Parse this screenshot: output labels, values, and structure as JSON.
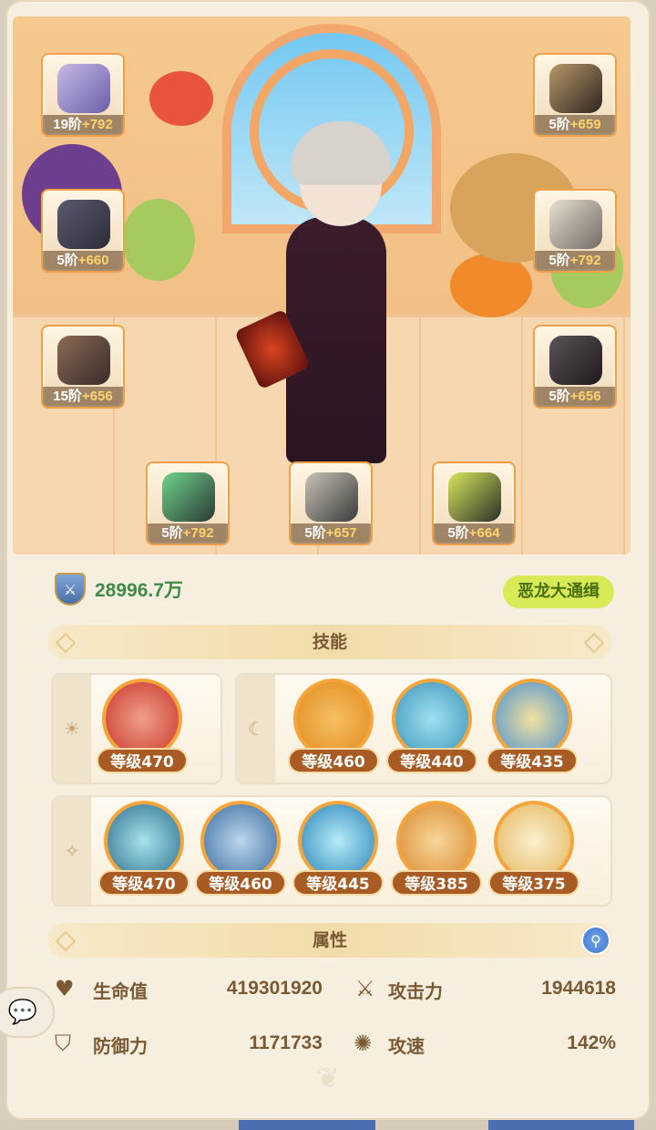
{
  "equipment": {
    "left": [
      {
        "name": "sword",
        "tier": "19阶",
        "bonus": "+792"
      },
      {
        "name": "chest-armor",
        "tier": "5阶",
        "bonus": "+660"
      },
      {
        "name": "leg-armor",
        "tier": "15阶",
        "bonus": "+656"
      }
    ],
    "right": [
      {
        "name": "helmet",
        "tier": "5阶",
        "bonus": "+659"
      },
      {
        "name": "gauntlets",
        "tier": "5阶",
        "bonus": "+792"
      },
      {
        "name": "boots",
        "tier": "5阶",
        "bonus": "+656"
      }
    ],
    "bottom": [
      {
        "name": "ring",
        "tier": "5阶",
        "bonus": "+792"
      },
      {
        "name": "necklace",
        "tier": "5阶",
        "bonus": "+657"
      },
      {
        "name": "amulet",
        "tier": "5阶",
        "bonus": "+664"
      }
    ]
  },
  "power": {
    "value": "28996.7万",
    "icon": "shield-sword-icon"
  },
  "bounty_label": "恶龙大通缉",
  "skills_header": "技能",
  "skill_rows": {
    "row1_left": {
      "icon": "sun-icon",
      "skills": [
        {
          "level": "等级470",
          "color": "#c9362b"
        }
      ]
    },
    "row1_right": {
      "icon": "moon-icon",
      "skills": [
        {
          "level": "等级460",
          "color": "#e08a1c"
        },
        {
          "level": "等级440",
          "color": "#3d95b8"
        },
        {
          "level": "等级435",
          "color": "#4a8fd0"
        }
      ]
    },
    "row2": {
      "icon": "star-icon",
      "skills": [
        {
          "level": "等级470",
          "color": "#2d6f8e"
        },
        {
          "level": "等级460",
          "color": "#3b6d9e"
        },
        {
          "level": "等级445",
          "color": "#2a84b5"
        },
        {
          "level": "等级385",
          "color": "#d98a2e"
        },
        {
          "level": "等级375",
          "color": "#e4b65c"
        }
      ]
    }
  },
  "attributes_header": "属性",
  "stats": [
    {
      "icon": "heart-icon",
      "label": "生命值",
      "value": "419301920"
    },
    {
      "icon": "crossed-swords-icon",
      "label": "攻击力",
      "value": "1944618"
    },
    {
      "icon": "shield-icon",
      "label": "防御力",
      "value": "1171733"
    },
    {
      "icon": "speed-icon",
      "label": "攻速",
      "value": "142%"
    }
  ],
  "colors": {
    "accent": "#f0a048",
    "power_green": "#3d8a4a",
    "bounty_bg": "#d8ea56",
    "text_brown": "#7a5a34"
  }
}
